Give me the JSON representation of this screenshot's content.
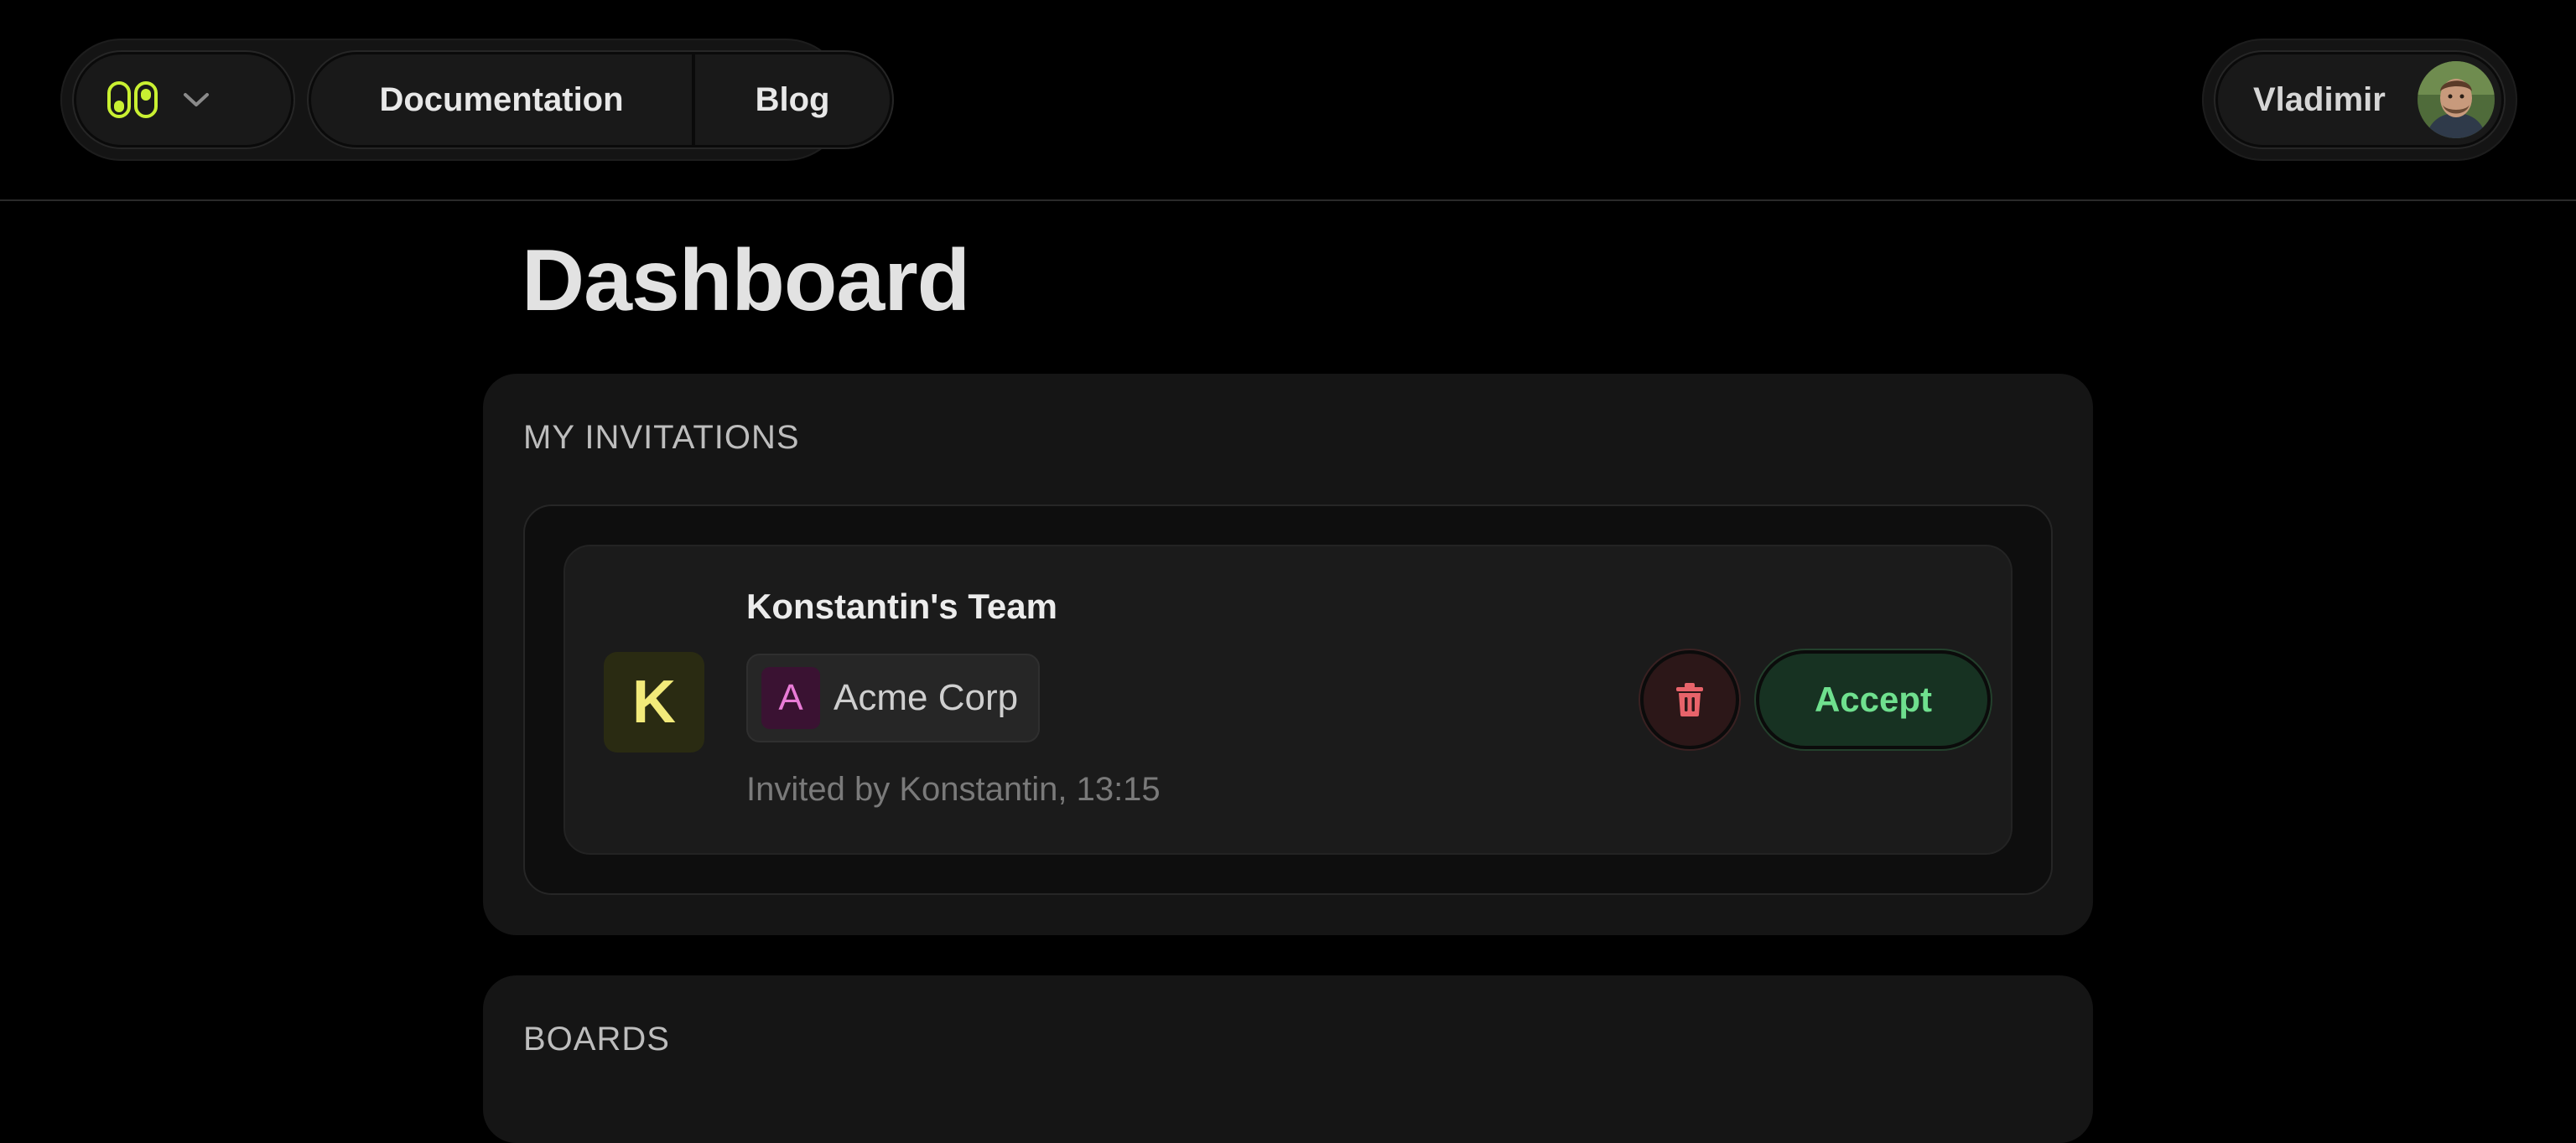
{
  "header": {
    "nav": {
      "documentation": "Documentation",
      "blog": "Blog"
    },
    "user": {
      "name": "Vladimir"
    }
  },
  "main": {
    "title": "Dashboard",
    "invitations": {
      "label": "MY INVITATIONS",
      "items": [
        {
          "badge_letter": "K",
          "team_name": "Konstantin's Team",
          "org_letter": "A",
          "org_name": "Acme Corp",
          "invited_by": "Invited by Konstantin, 13:15",
          "accept_label": "Accept"
        }
      ]
    },
    "boards": {
      "label": "BOARDS"
    }
  },
  "colors": {
    "background": "#000000",
    "panel": "#151515",
    "logo_accent": "#c9f032",
    "team_badge_bg": "#2a2b12",
    "team_badge_fg": "#f2ea7a",
    "org_badge_bg": "#3a1232",
    "org_badge_fg": "#e97bd6",
    "decline": "#e8636a",
    "accept": "#6fe08e"
  },
  "icons": {
    "logo": "eyes-logo-icon",
    "workspace_menu": "chevron-down-icon",
    "decline": "trash-icon"
  }
}
